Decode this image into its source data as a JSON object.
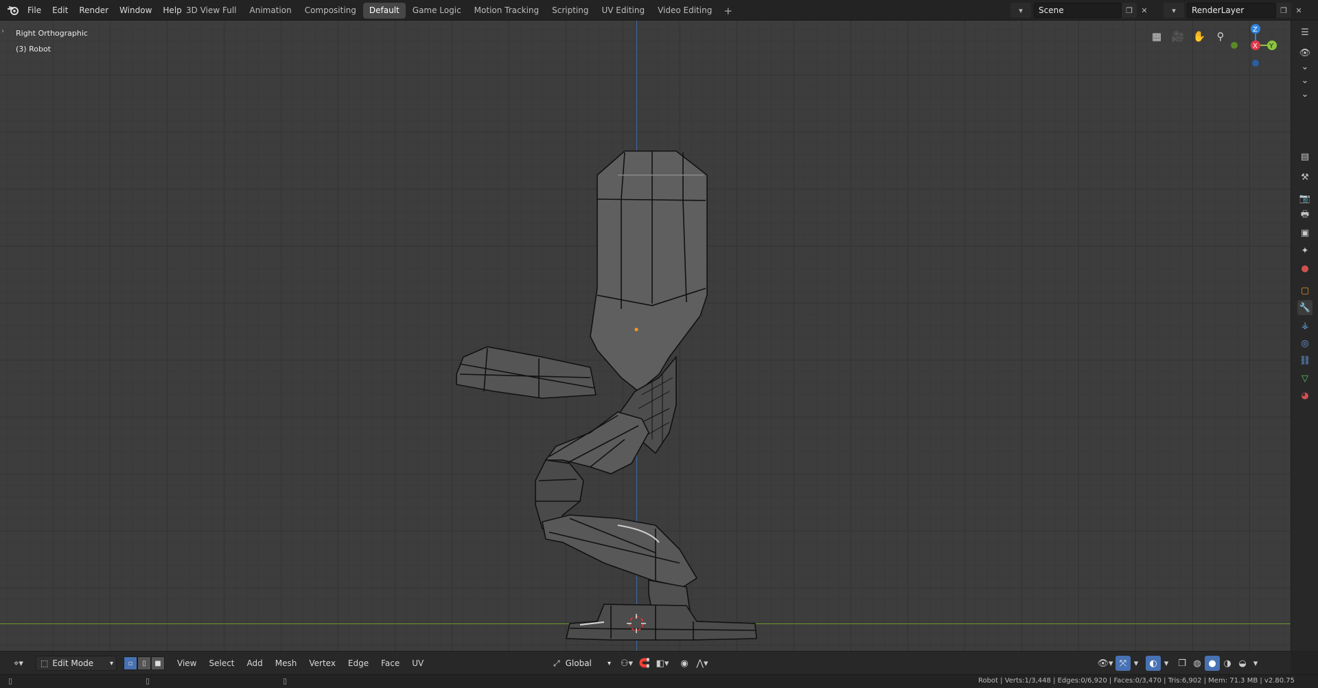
{
  "topbar": {
    "menu": [
      "File",
      "Edit",
      "Render",
      "Window",
      "Help"
    ],
    "workspaces": [
      "3D View Full",
      "Animation",
      "Compositing",
      "Default",
      "Game Logic",
      "Motion Tracking",
      "Scripting",
      "UV Editing",
      "Video Editing"
    ],
    "active_workspace": "Default",
    "scene": "Scene",
    "render_layer": "RenderLayer"
  },
  "viewport": {
    "view_name": "Right Orthographic",
    "object_label": "(3) Robot",
    "gizmo_axes": {
      "z": "Z",
      "x": "X",
      "y": "Y"
    }
  },
  "header": {
    "mode": "Edit Mode",
    "menus": [
      "View",
      "Select",
      "Add",
      "Mesh",
      "Vertex",
      "Edge",
      "Face",
      "UV"
    ],
    "orientation": "Global"
  },
  "statusbar": {
    "text": "Robot | Verts:1/3,448 | Edges:0/6,920 | Faces:0/3,470 | Tris:6,902 | Mem: 71.3 MB | v2.80.75"
  },
  "colors": {
    "accent": "#4772b3",
    "x_axis": "#e5384b",
    "y_axis": "#8bc53f",
    "z_axis": "#2f85e0"
  }
}
